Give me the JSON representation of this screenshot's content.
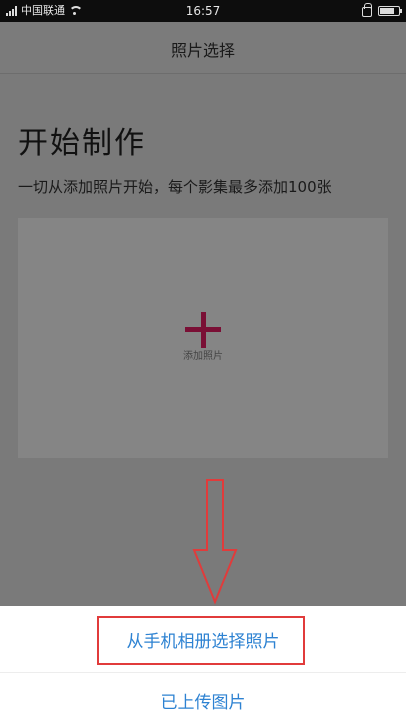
{
  "status_bar": {
    "carrier": "中国联通",
    "time": "16:57",
    "battery_level_percent": 80,
    "icons": [
      "signal-icon",
      "wifi-icon",
      "lock-icon",
      "battery-icon"
    ]
  },
  "nav": {
    "title": "照片选择"
  },
  "content": {
    "heading": "开始制作",
    "subtitle": "一切从添加照片开始，每个影集最多添加100张",
    "add_box": {
      "label": "添加照片",
      "icon": "plus-icon"
    }
  },
  "sheet": {
    "options": [
      {
        "label": "从手机相册选择照片"
      },
      {
        "label": "已上传图片"
      }
    ]
  },
  "colors": {
    "accent_plus": "#7a0f35",
    "option_text": "#2d82d2",
    "annotation_red": "#e13b3b",
    "overlay_gray": "#7b7b7b"
  }
}
